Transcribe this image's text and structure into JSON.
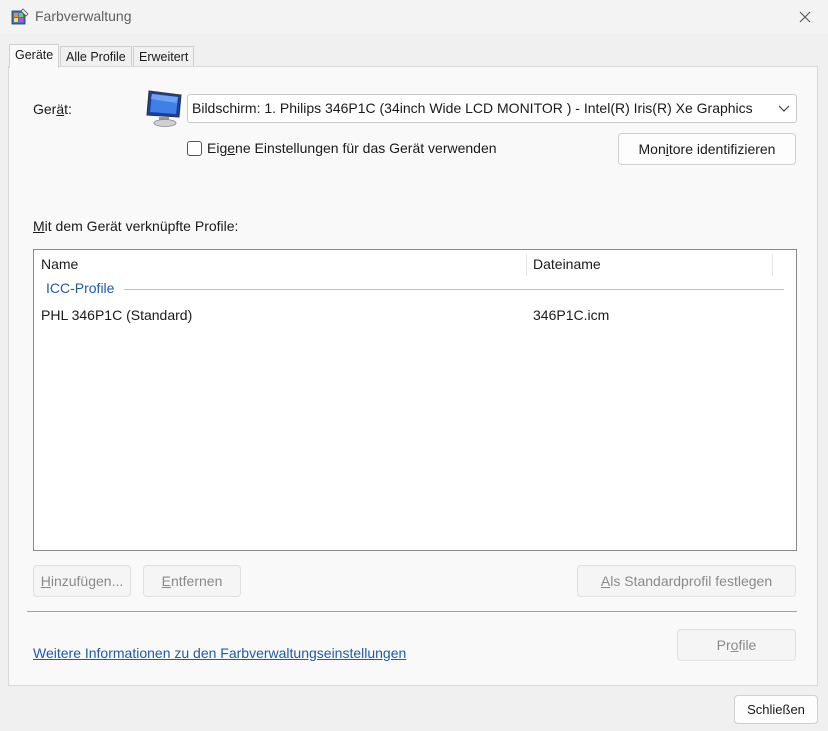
{
  "window": {
    "title": "Farbverwaltung"
  },
  "tabs": [
    {
      "label": "Geräte",
      "active": true
    },
    {
      "label": "Alle Profile",
      "active": false
    },
    {
      "label": "Erweitert",
      "active": false
    }
  ],
  "device": {
    "label_pre": "Ger",
    "label_u": "ä",
    "label_post": "t:",
    "selected": "Bildschirm: 1. Philips 346P1C (34inch Wide LCD MONITOR ) - Intel(R) Iris(R) Xe Graphics",
    "checkbox_pre": "Eig",
    "checkbox_u": "e",
    "checkbox_post": "ne Einstellungen für das Gerät verwenden",
    "checkbox_checked": false,
    "identify_pre": "Mon",
    "identify_u": "i",
    "identify_post": "tore identifizieren"
  },
  "profiles": {
    "heading_u": "M",
    "heading_post": "it dem Gerät verknüpfte Profile:",
    "columns": [
      "Name",
      "Dateiname"
    ],
    "group": "ICC-Profile",
    "rows": [
      {
        "name": "PHL 346P1C (Standard)",
        "file": "346P1C.icm"
      }
    ]
  },
  "buttons": {
    "add_u": "H",
    "add_post": "inzufügen...",
    "remove_u": "E",
    "remove_post": "ntfernen",
    "set_default_u": "A",
    "set_default_post": "ls Standardprofil festlegen",
    "profile_pre": "Pr",
    "profile_u": "o",
    "profile_post": "file",
    "close": "Schließen"
  },
  "link": {
    "text": "Weitere Informationen zu den Farbverwaltungseinstellungen"
  },
  "colors": {
    "link": "#1f5ba8",
    "group": "#1f5ba8",
    "disabled_text": "#8a8a8a"
  }
}
